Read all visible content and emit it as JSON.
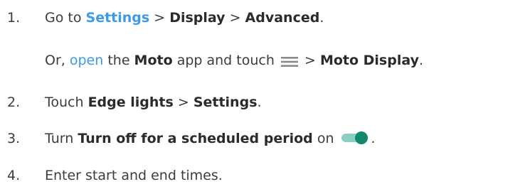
{
  "steps": [
    {
      "number": "1.",
      "prefix": "Go to ",
      "link": "Settings",
      "sep1": " > ",
      "item1": "Display",
      "sep2": " > ",
      "item2": "Advanced",
      "suffix": ".",
      "alt": {
        "prefix": "Or, ",
        "link": "open",
        "mid": " the ",
        "app": "Moto",
        "mid2": " app and touch ",
        "sep": " > ",
        "item": "Moto Display",
        "suffix": ".",
        "icon": "menu-icon"
      }
    },
    {
      "number": "2.",
      "prefix": "Touch ",
      "item1": "Edge lights",
      "sep": " > ",
      "item2": "Settings",
      "suffix": "."
    },
    {
      "number": "3.",
      "prefix": "Turn ",
      "item": "Turn off for a scheduled period",
      "mid": " on ",
      "suffix": ".",
      "icon": "toggle-on-icon"
    },
    {
      "number": "4.",
      "text": "Enter start and end times."
    }
  ],
  "colors": {
    "link": "#3d9ae8",
    "text": "#3c3c3c",
    "toggle_track": "#8ad0c2",
    "toggle_knob": "#0f8a6e",
    "icon_gray": "#8a8a8a"
  }
}
